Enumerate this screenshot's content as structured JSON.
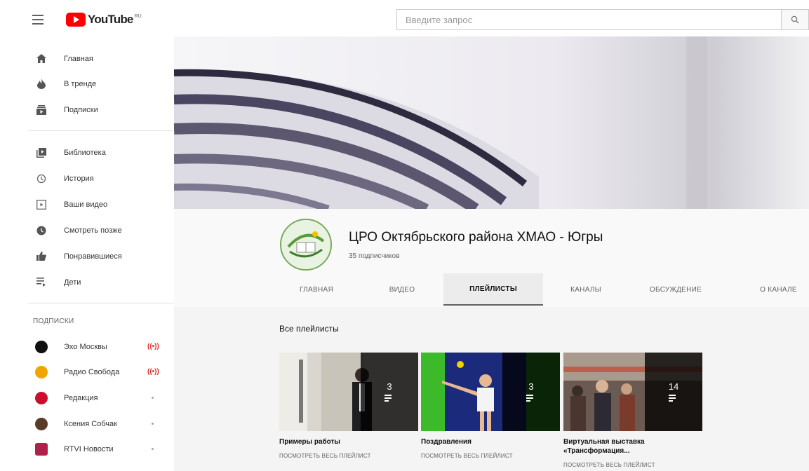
{
  "header": {
    "logo_text": "YouTube",
    "region": "RU",
    "search_placeholder": "Введите запрос"
  },
  "sidebar": {
    "main_items": [
      {
        "label": "Главная",
        "icon": "home-icon"
      },
      {
        "label": "В тренде",
        "icon": "trending-icon"
      },
      {
        "label": "Подписки",
        "icon": "subscriptions-icon"
      }
    ],
    "library_items": [
      {
        "label": "Библиотека",
        "icon": "library-icon"
      },
      {
        "label": "История",
        "icon": "history-icon"
      },
      {
        "label": "Ваши видео",
        "icon": "your-videos-icon"
      },
      {
        "label": "Смотреть позже",
        "icon": "watch-later-icon"
      },
      {
        "label": "Понравившиеся",
        "icon": "thumbs-up-icon"
      },
      {
        "label": "Дети",
        "icon": "playlist-icon"
      }
    ],
    "subscriptions_header": "ПОДПИСКИ",
    "subscriptions": [
      {
        "label": "Эхо Москвы",
        "status": "live",
        "color": "#111111"
      },
      {
        "label": "Радио Свобода",
        "status": "live",
        "color": "#f0a500"
      },
      {
        "label": "Редакция",
        "status": "new",
        "color": "#c8102e"
      },
      {
        "label": "Ксения Собчак",
        "status": "new",
        "color": "#5a3b2a"
      },
      {
        "label": "RTVI Новости",
        "status": "new",
        "color": "#b0204a"
      }
    ]
  },
  "channel": {
    "title": "ЦРО Октябрьского района ХМАО - Югры",
    "subscribers": "35 подписчиков",
    "tabs": [
      "ГЛАВНАЯ",
      "ВИДЕО",
      "ПЛЕЙЛИСТЫ",
      "КАНАЛЫ",
      "ОБСУЖДЕНИЕ",
      "О КАНАЛЕ"
    ],
    "active_tab": "ПЛЕЙЛИСТЫ"
  },
  "playlists": {
    "section_title": "Все плейлисты",
    "items": [
      {
        "title": "Примеры работы",
        "count": "3",
        "link": "ПОСМОТРЕТЬ ВЕСЬ ПЛЕЙЛИСТ"
      },
      {
        "title": "Поздравления",
        "count": "3",
        "link": "ПОСМОТРЕТЬ ВЕСЬ ПЛЕЙЛИСТ"
      },
      {
        "title": "Виртуальная выставка «Трансформация...",
        "count": "14",
        "link": "ПОСМОТРЕТЬ ВЕСЬ ПЛЕЙЛИСТ"
      }
    ]
  },
  "colors": {
    "brand_red": "#ff0000",
    "live_red": "#e52d27"
  }
}
